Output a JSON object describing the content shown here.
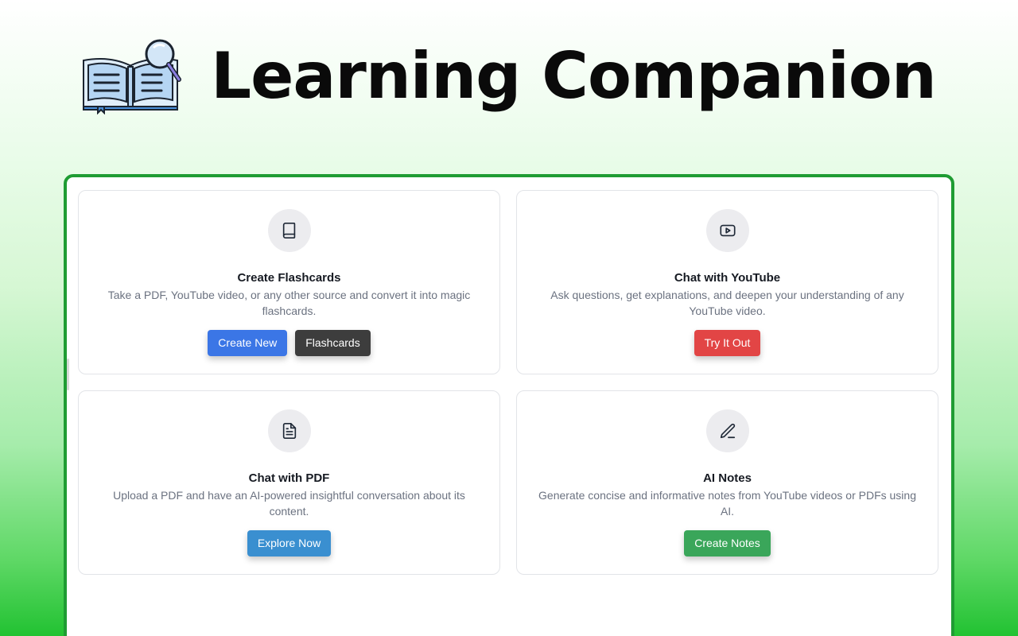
{
  "header": {
    "title": "Learning Companion",
    "logo_icon": "open-book-magnifier-icon"
  },
  "colors": {
    "title": "#0a0a0a",
    "panel_border": "#1f9c33",
    "blue": "#3b76e6",
    "dark": "#3d3d3d",
    "red": "#e24545",
    "sky": "#3a8fd0",
    "green": "#3aa65a"
  },
  "cards": [
    {
      "icon": "book-icon",
      "title": "Create Flashcards",
      "description": "Take a PDF, YouTube video, or any other source and convert it into magic flashcards.",
      "buttons": [
        {
          "label": "Create New",
          "color": "#3b76e6"
        },
        {
          "label": "Flashcards",
          "color": "#3d3d3d"
        }
      ]
    },
    {
      "icon": "youtube-play-icon",
      "title": "Chat with YouTube",
      "description": "Ask questions, get explanations, and deepen your understanding of any YouTube video.",
      "buttons": [
        {
          "label": "Try It Out",
          "color": "#e24545"
        }
      ]
    },
    {
      "icon": "document-icon",
      "title": "Chat with PDF",
      "description": "Upload a PDF and have an AI-powered insightful conversation about its content.",
      "buttons": [
        {
          "label": "Explore Now",
          "color": "#3a8fd0"
        }
      ]
    },
    {
      "icon": "pen-icon",
      "title": "AI Notes",
      "description": "Generate concise and informative notes from YouTube videos or PDFs using AI.",
      "buttons": [
        {
          "label": "Create Notes",
          "color": "#3aa65a"
        }
      ]
    }
  ]
}
